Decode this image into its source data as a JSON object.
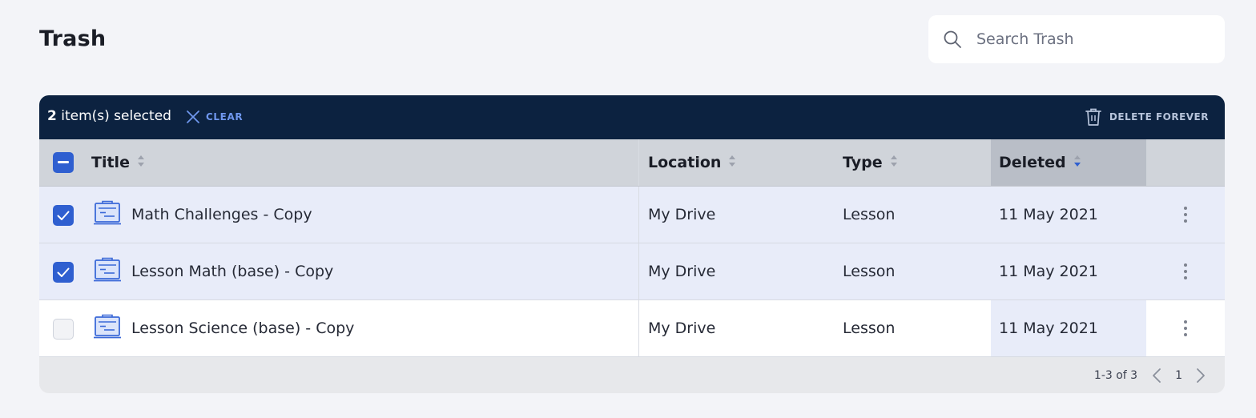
{
  "page": {
    "title": "Trash"
  },
  "search": {
    "placeholder": "Search Trash"
  },
  "selection": {
    "count": "2",
    "label": " item(s) selected",
    "clear_label": "CLEAR",
    "delete_label": "DELETE FOREVER"
  },
  "columns": {
    "title": "Title",
    "location": "Location",
    "type": "Type",
    "deleted": "Deleted"
  },
  "rows": [
    {
      "title": "Math Challenges - Copy",
      "location": "My Drive",
      "type": "Lesson",
      "deleted": "11 May 2021",
      "selected": true
    },
    {
      "title": "Lesson Math (base) - Copy",
      "location": "My Drive",
      "type": "Lesson",
      "deleted": "11 May 2021",
      "selected": true
    },
    {
      "title": "Lesson Science (base) - Copy",
      "location": "My Drive",
      "type": "Lesson",
      "deleted": "11 May 2021",
      "selected": false
    }
  ],
  "pagination": {
    "range": "1-3 of 3",
    "page": "1"
  },
  "colors": {
    "selection_bar": "#0c2240",
    "accent": "#2f5fd0",
    "selected_row": "#e8ecf9"
  },
  "icons": [
    "search-icon",
    "close-icon",
    "trash-icon",
    "sort-icon",
    "lesson-icon",
    "more-vertical-icon",
    "chevron-left-icon",
    "chevron-right-icon"
  ]
}
